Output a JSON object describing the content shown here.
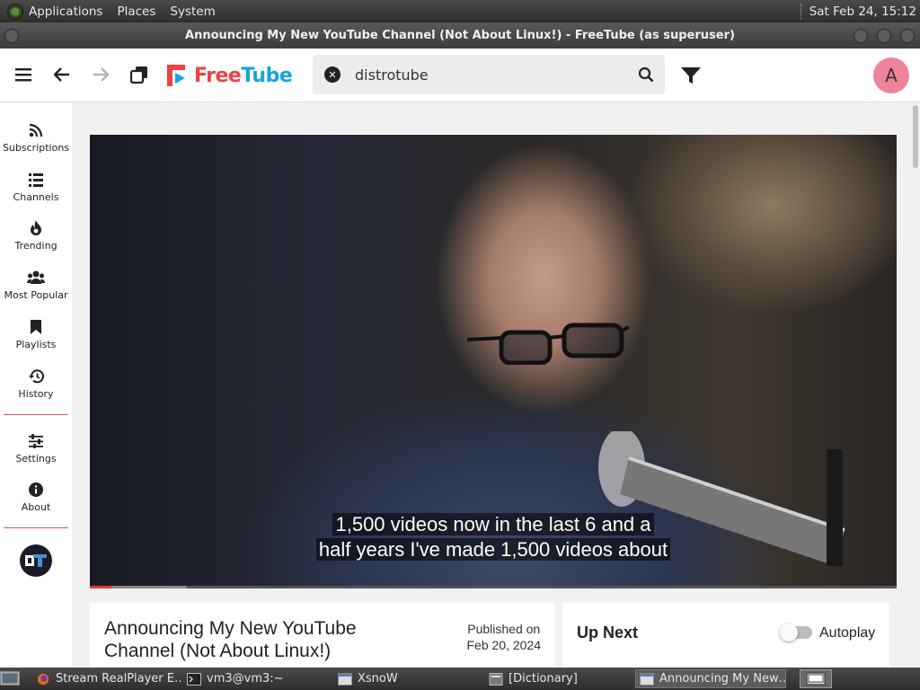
{
  "desktop_panel": {
    "menus": [
      "Applications",
      "Places",
      "System"
    ],
    "clock": "Sat Feb 24, 15:12"
  },
  "window": {
    "title": "Announcing My New YouTube Channel (Not About Linux!) - FreeTube (as superuser)"
  },
  "header": {
    "logo_part1": "Free",
    "logo_part2": "Tube",
    "search_value": "distrotube",
    "avatar_letter": "A",
    "colors": {
      "logo_red": "#f04242",
      "logo_blue": "#14a4df",
      "avatar_bg": "#f0829a"
    }
  },
  "sidebar": {
    "items": [
      {
        "label": "Subscriptions",
        "icon": "rss-icon"
      },
      {
        "label": "Channels",
        "icon": "list-icon"
      },
      {
        "label": "Trending",
        "icon": "fire-icon"
      },
      {
        "label": "Most Popular",
        "icon": "users-icon"
      },
      {
        "label": "Playlists",
        "icon": "bookmark-icon"
      },
      {
        "label": "History",
        "icon": "history-icon"
      }
    ],
    "bottom_items": [
      {
        "label": "Settings",
        "icon": "sliders-icon"
      },
      {
        "label": "About",
        "icon": "info-icon"
      }
    ],
    "divider_color": "#e05555"
  },
  "video": {
    "caption_line1": "1,500 videos now in the last 6 and a",
    "caption_line2": "half years I've made 1,500 videos about",
    "progress_fraction": 0.027,
    "buffered_fraction": 0.12
  },
  "info": {
    "title": "Announcing My New YouTube Channel (Not About Linux!)",
    "published_label": "Published on",
    "published_date": "Feb 20, 2024"
  },
  "up_next": {
    "title": "Up Next",
    "autoplay_label": "Autoplay",
    "autoplay_on": false
  },
  "taskbar": {
    "tasks": [
      {
        "label": "Stream RealPlayer E…",
        "icon": "firefox-icon"
      },
      {
        "label": "vm3@vm3:~",
        "icon": "terminal-icon"
      },
      {
        "label": "XsnoW",
        "icon": "window-icon"
      },
      {
        "label": "[Dictionary]",
        "icon": "dictionary-icon"
      },
      {
        "label": "Announcing My New…",
        "icon": "window-icon",
        "active": true
      }
    ]
  }
}
